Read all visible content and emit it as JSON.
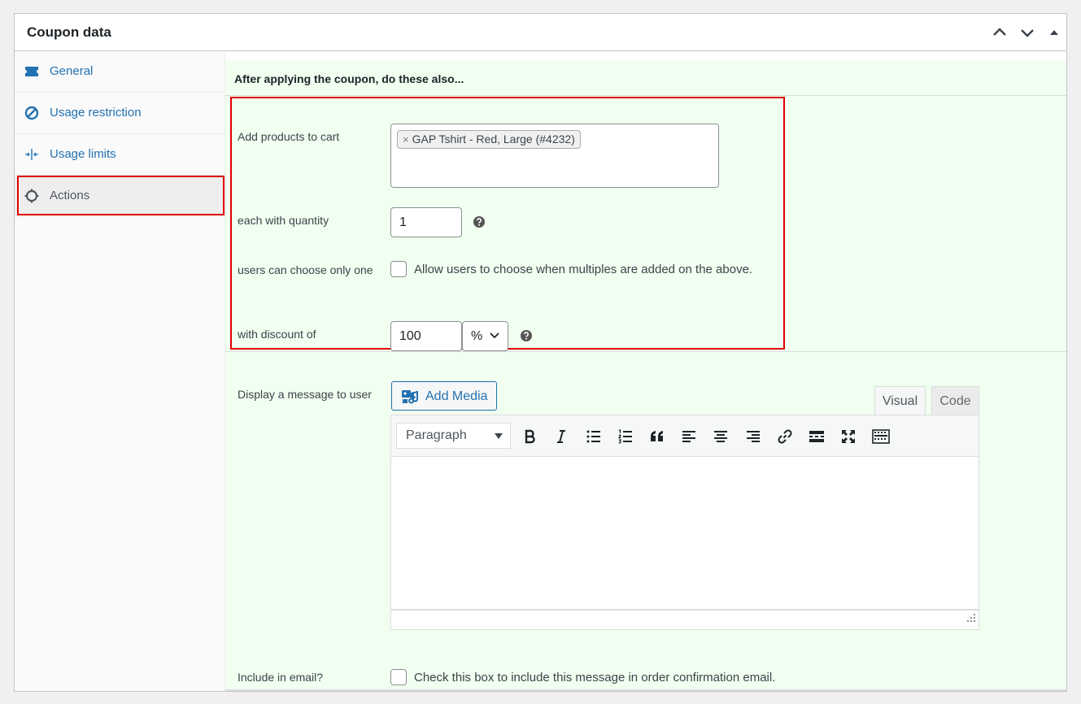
{
  "panel": {
    "title": "Coupon data"
  },
  "sidebar": {
    "items": [
      {
        "label": "General",
        "icon": "ticket-icon"
      },
      {
        "label": "Usage restriction",
        "icon": "block-icon"
      },
      {
        "label": "Usage limits",
        "icon": "arrows-in-icon"
      },
      {
        "label": "Actions",
        "icon": "gear-icon",
        "active": true
      }
    ]
  },
  "actions": {
    "section_title": "After applying the coupon, do these also...",
    "add_products_label": "Add products to cart",
    "selected_product": "GAP Tshirt - Red, Large (#4232)",
    "chip_remove": "×",
    "quantity_label": "each with quantity",
    "quantity_value": "1",
    "choose_one_label": "users can choose only one",
    "choose_one_checkbox_label": "Allow users to choose when multiples are added on the above.",
    "discount_label": "with discount of",
    "discount_value": "100",
    "discount_type": "%",
    "message_label": "Display a message to user",
    "add_media_label": "Add Media",
    "editor_tab_visual": "Visual",
    "editor_tab_code": "Code",
    "format_select": "Paragraph",
    "include_email_label": "Include in email?",
    "include_email_checkbox_label": "Check this box to include this message in order confirmation email."
  },
  "colors": {
    "link_blue": "#2271b1",
    "highlight_red": "#e00000",
    "section_bg": "#f0fff0"
  }
}
